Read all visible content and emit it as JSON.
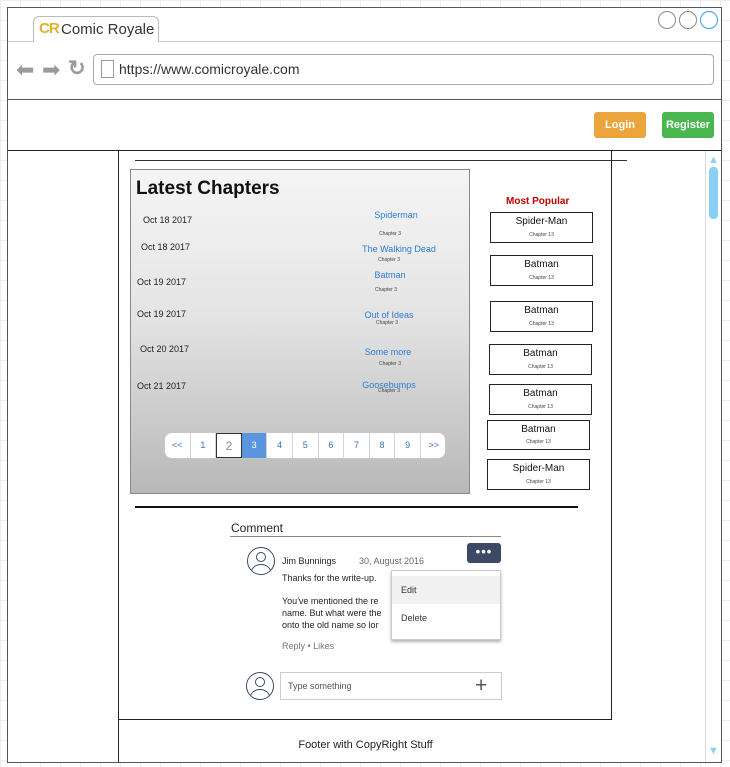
{
  "browser": {
    "tab_logo": "CR",
    "tab_title": "Comic Royale",
    "url": "https://www.comicroyale.com"
  },
  "header": {
    "login_label": "Login",
    "register_label": "Register"
  },
  "latest": {
    "title": "Latest Chapters",
    "rows": [
      {
        "date": "Oct 18 2017",
        "title": "Spiderman",
        "chapter": "Chapter 3"
      },
      {
        "date": "Oct 18 2017",
        "title": "The Walking Dead",
        "chapter": "Chapter 3"
      },
      {
        "date": "Oct 19 2017",
        "title": "Batman",
        "chapter": "Chapter 3"
      },
      {
        "date": "Oct 19 2017",
        "title": "Out of Ideas",
        "chapter": "Chapter 3"
      },
      {
        "date": "Oct 20 2017",
        "title": "Some more",
        "chapter": "Chapter 3"
      },
      {
        "date": "Oct 21 2017",
        "title": "Goosebumps",
        "chapter": "Chapter 3"
      }
    ],
    "pagination": [
      "<<",
      "1",
      "2",
      "3",
      "4",
      "5",
      "6",
      "7",
      "8",
      "9",
      ">>"
    ]
  },
  "popular": {
    "title": "Most Popular",
    "items": [
      {
        "name": "Spider-Man",
        "chapter": "Chapter 13"
      },
      {
        "name": "Batman",
        "chapter": "Chapter 13"
      },
      {
        "name": "Batman",
        "chapter": "Chapter 13"
      },
      {
        "name": "Batman",
        "chapter": "Chapter 13"
      },
      {
        "name": "Batman",
        "chapter": "Chapter 13"
      },
      {
        "name": "Batman",
        "chapter": "Chapter 13"
      },
      {
        "name": "Spider-Man",
        "chapter": "Chapter 13"
      }
    ]
  },
  "comments": {
    "label": "Comment",
    "author": "Jim Bunnings",
    "date": "30, August 2016",
    "line1": "Thanks for the write-up.",
    "line2": "You've mentioned the re",
    "line3": "name. But what were the",
    "line4": "onto the old name so lor",
    "actions": "Reply • Likes",
    "menu_dots": "•••",
    "menu_edit": "Edit",
    "menu_delete": "Delete",
    "input_placeholder": "Type something",
    "input_plus": "+"
  },
  "footer": {
    "text": "Footer with CopyRight Stuff"
  }
}
